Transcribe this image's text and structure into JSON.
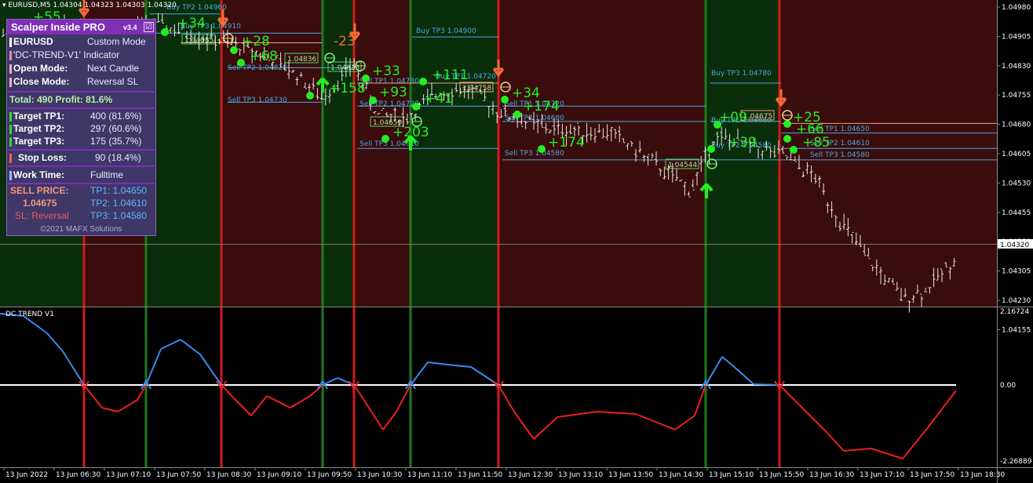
{
  "symbol_bar": "EURUSD,M5  1.04304 1.04323 1.04303 1.04320",
  "indicator_label": "DC TREND V1",
  "colors": {
    "green_zone": "#0a2d0a",
    "red_zone": "#3a0c0c",
    "green_line": "#1d7a1d",
    "red_line": "#d11a1a",
    "candle": "#e6e6e6",
    "tp_line": "#4aa8e0",
    "entry_line": "#f6a07a",
    "profit_green": "#22ee22",
    "loss_orange": "#f46a3a",
    "trend_up": "#3a8af0",
    "trend_down": "#ee1e1e"
  },
  "price_axis": [
    "1.04980",
    "1.04905",
    "1.04830",
    "1.04755",
    "1.04680",
    "1.04605",
    "1.04530",
    "1.04455",
    "1.04380",
    "1.04305",
    "1.04230",
    "1.04155"
  ],
  "current_price": "1.04320",
  "indicator_axis": [
    "2.16724",
    "0.00",
    "-2.26889"
  ],
  "time_axis": [
    "13 Jun 2022",
    "13 Jun 06:30",
    "13 Jun 07:10",
    "13 Jun 07:50",
    "13 Jun 08:30",
    "13 Jun 09:10",
    "13 Jun 09:50",
    "13 Jun 10:30",
    "13 Jun 11:10",
    "13 Jun 11:50",
    "13 Jun 12:30",
    "13 Jun 13:10",
    "13 Jun 13:50",
    "13 Jun 14:30",
    "13 Jun 15:10",
    "13 Jun 15:50",
    "13 Jun 16:30",
    "13 Jun 17:10",
    "13 Jun 17:50",
    "13 Jun 18:30"
  ],
  "panel": {
    "title": "Scalper Inside PRO",
    "version": "v3.4",
    "check": "☑",
    "symbol": "EURUSD",
    "mode": "Custom Mode",
    "indicator": "'DC-TREND-V1' Indicator",
    "open_label": "Open Mode:",
    "open_value": "Next Candle",
    "close_label": "Close Mode:",
    "close_value": "Reversal SL",
    "total": "Total: 490  Profit: 81.6%",
    "tp1_label": "Target TP1:",
    "tp1_value": "400 (81.6%)",
    "tp2_label": "Target TP2:",
    "tp2_value": "297 (60.6%)",
    "tp3_label": "Target TP3:",
    "tp3_value": "175 (35.7%)",
    "sl_label": "Stop Loss:",
    "sl_value": "90 (18.4%)",
    "work_label": "Work Time:",
    "work_value": "Fulltime",
    "sell_label": "SELL PRICE:",
    "sell_price": "1.04675",
    "sl_text": "SL: Reversal",
    "tp1_text": "TP1: 1.04650",
    "tp2_text": "TP2: 1.04610",
    "tp3_text": "TP3: 1.04580",
    "copyright": "©2021 MAFX Solutions"
  },
  "annotations": {
    "profits": [
      "+55",
      "+34",
      "+28",
      "+68",
      "-23",
      "+33",
      "+158",
      "+93",
      "+203",
      "+111",
      "+41",
      "+34",
      "+174",
      "+174",
      "+09",
      "+39",
      "+25",
      "+66",
      "+85"
    ],
    "tp_labels": [
      "Buy TP2 1.04960",
      "Buy TP3 1.04910",
      "Buy TP3 1.04900",
      "Sell TP2 1.04820",
      "Sell TP3 1.04730",
      "Sell TP1 1.04780",
      "Sell TP2 1.04720",
      "Sell TP3 1.04610",
      "Buy TP1 1.04720",
      "Sell TP1 1.04720",
      "Sell TP2 1.04680",
      "Sell TP3 1.04580",
      "Buy TP3 1.04780",
      "Buy TP1 1.04680",
      "Buy TP2 1.04580",
      "Sell TP1 1.04650",
      "Sell TP2 1.04610",
      "Sell TP3 1.04580"
    ],
    "entry_boxes": [
      "1.04885",
      "1.04836",
      "1.04813",
      "1.04758",
      "1.04659",
      "1.04544",
      "1.04675"
    ]
  }
}
